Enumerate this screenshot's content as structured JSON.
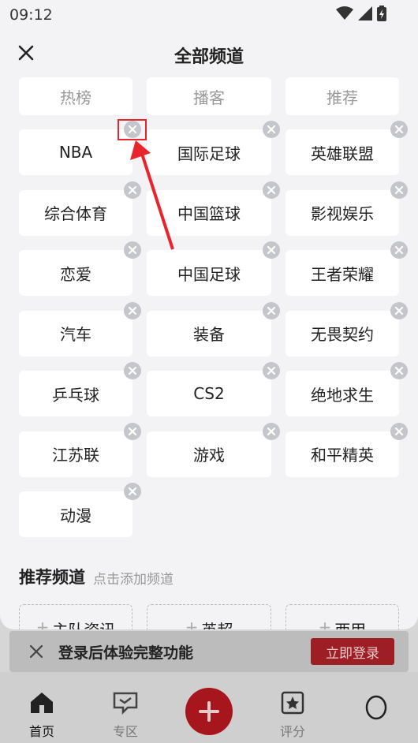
{
  "status": {
    "time": "09:12"
  },
  "header": {
    "title": "全部频道"
  },
  "fixed_channels": [
    "热榜",
    "播客",
    "推荐"
  ],
  "my_channels": [
    "NBA",
    "国际足球",
    "英雄联盟",
    "综合体育",
    "中国篮球",
    "影视娱乐",
    "恋爱",
    "中国足球",
    "王者荣耀",
    "汽车",
    "装备",
    "无畏契约",
    "乒乓球",
    "CS2",
    "绝地求生",
    "江苏联",
    "游戏",
    "和平精英",
    "动漫"
  ],
  "recommended": {
    "title": "推荐频道",
    "subtitle": "点击添加频道",
    "items": [
      "主队资讯",
      "英超",
      "西甲"
    ]
  },
  "login_banner": {
    "text": "登录后体验完整功能",
    "button": "立即登录"
  },
  "tabbar": {
    "home": "首页",
    "zone": "专区",
    "rating": "评分"
  },
  "annotation": {
    "color": "#e8242c"
  },
  "colors": {
    "accent": "#a6161c",
    "badge": "#c5c5cc",
    "sheet_bg": "#f3f3f5"
  }
}
